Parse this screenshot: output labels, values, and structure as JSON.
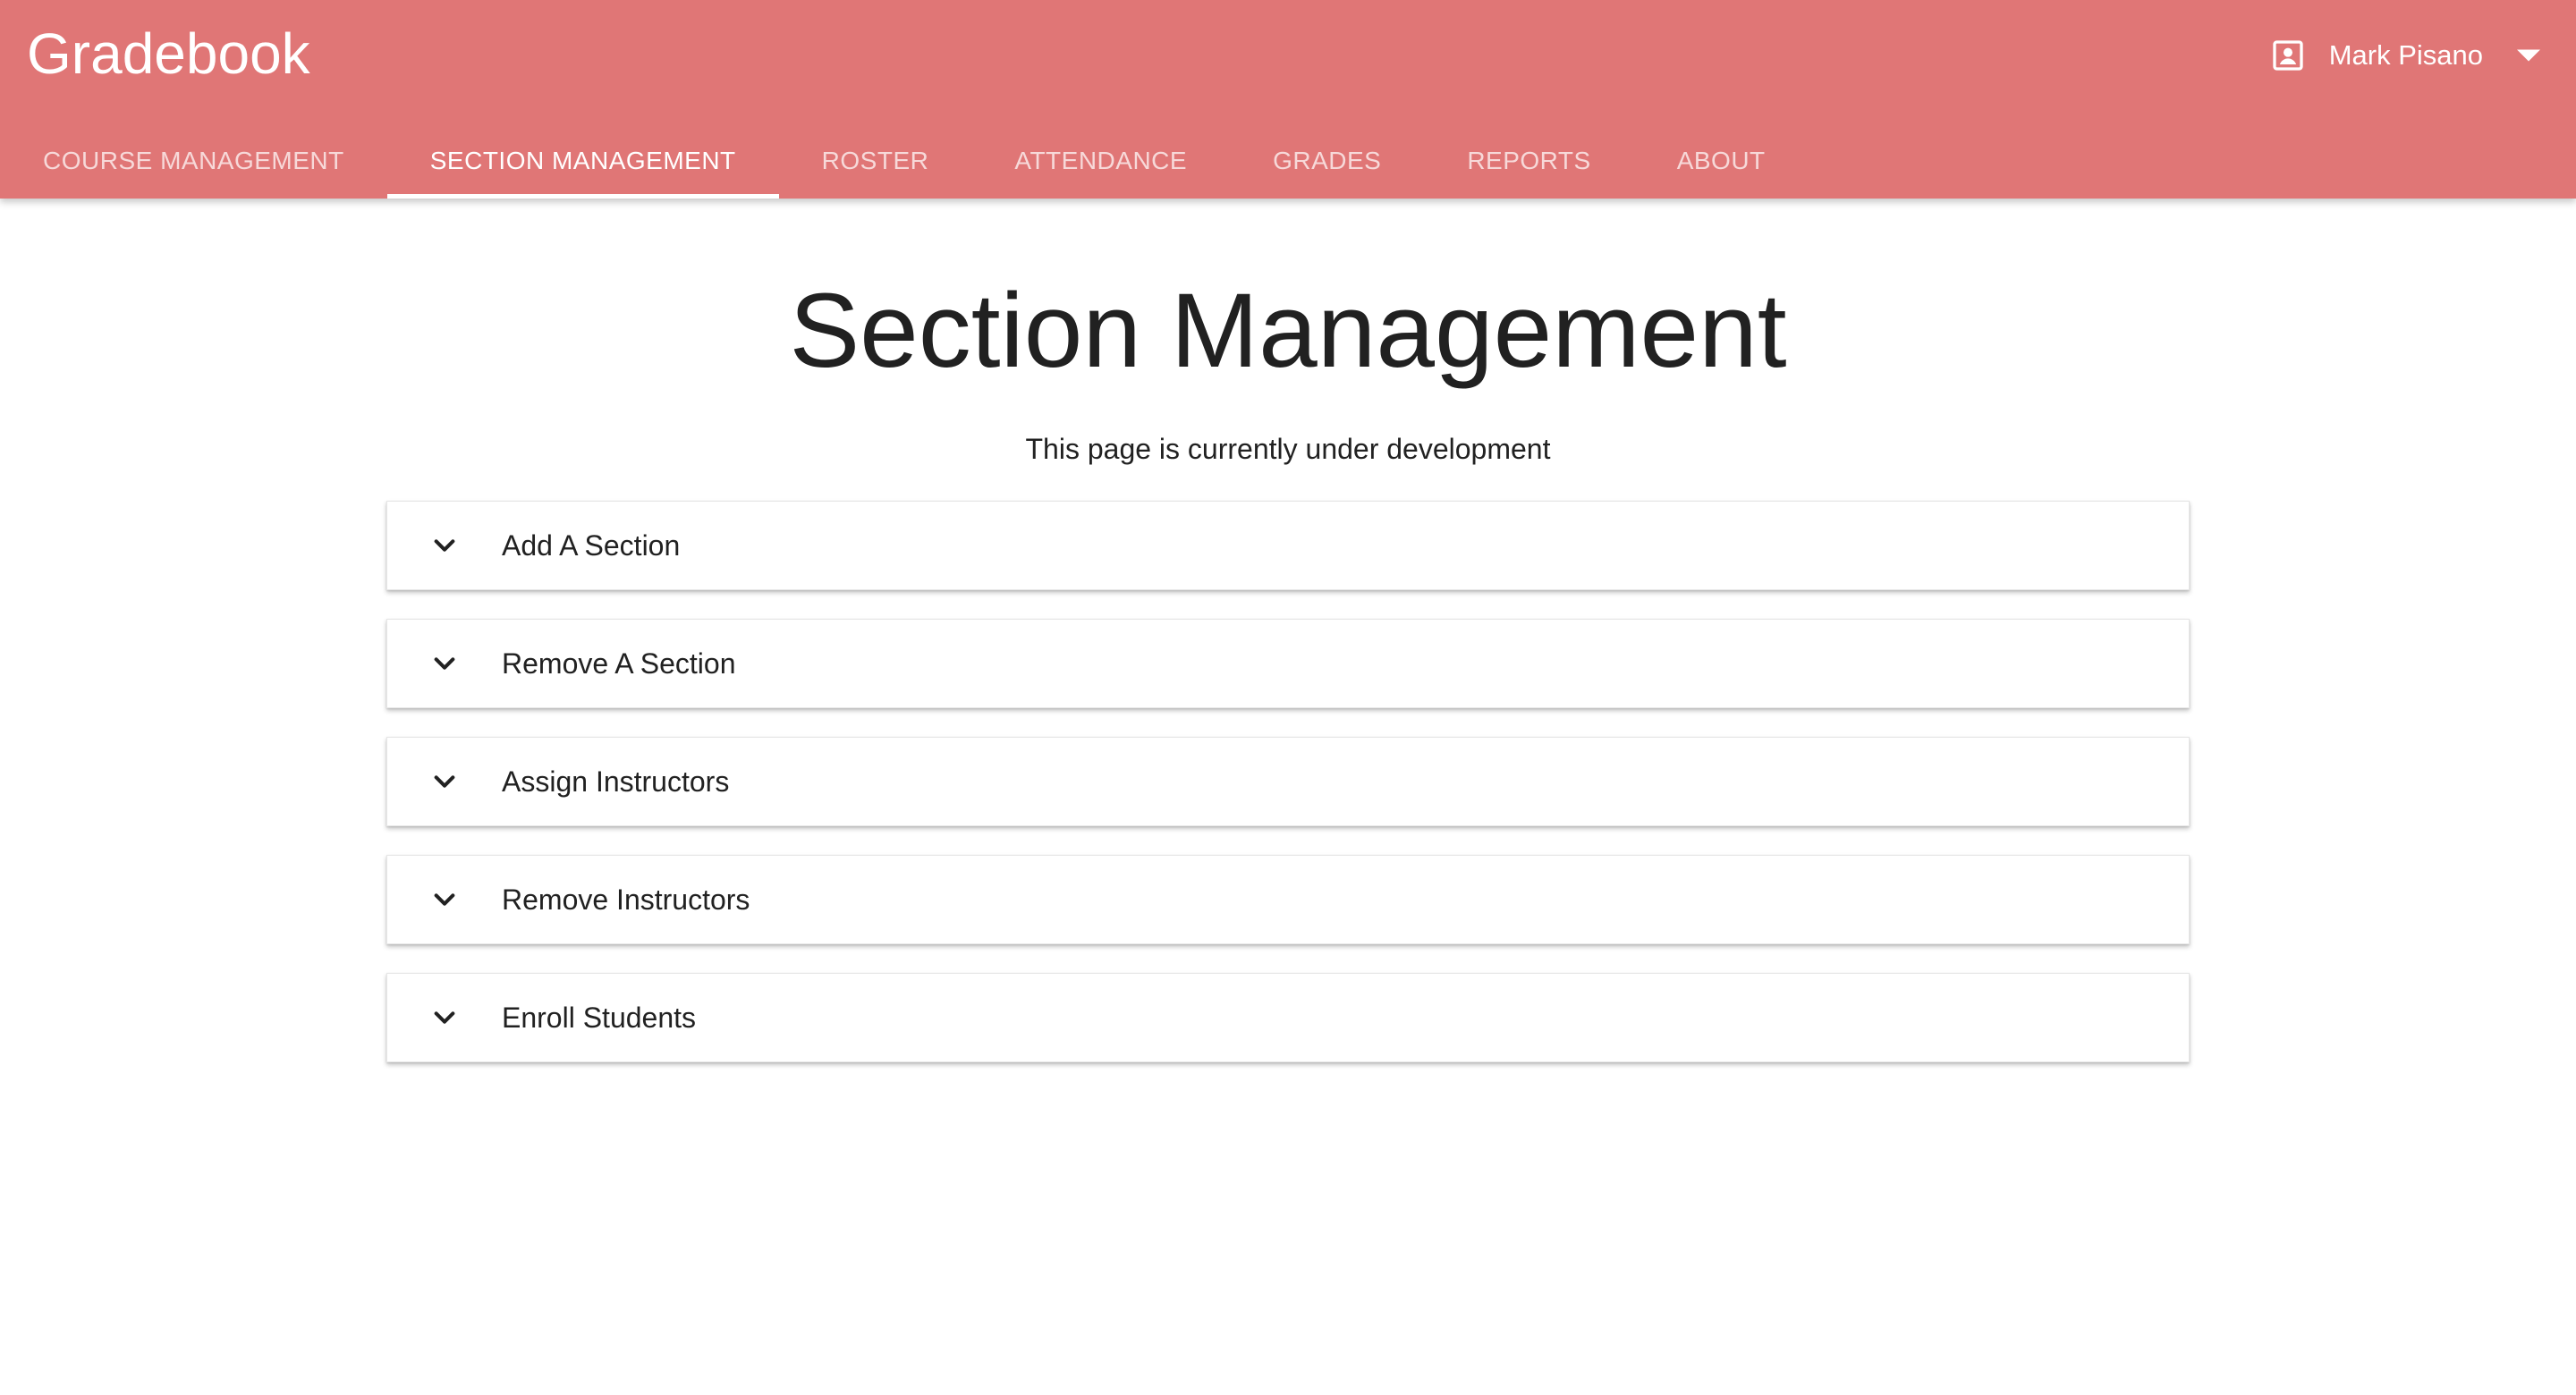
{
  "app": {
    "title": "Gradebook",
    "brand_color": "#e07676"
  },
  "user": {
    "name": "Mark Pisano",
    "icon": "account-box-icon",
    "menu_icon": "caret-down-icon"
  },
  "tabs": [
    {
      "label": "COURSE MANAGEMENT",
      "active": false
    },
    {
      "label": "SECTION MANAGEMENT",
      "active": true
    },
    {
      "label": "ROSTER",
      "active": false
    },
    {
      "label": "ATTENDANCE",
      "active": false
    },
    {
      "label": "GRADES",
      "active": false
    },
    {
      "label": "REPORTS",
      "active": false
    },
    {
      "label": "ABOUT",
      "active": false
    }
  ],
  "main": {
    "title": "Section Management",
    "subtitle": "This page is currently under development",
    "panels": [
      {
        "label": "Add A Section",
        "icon": "chevron-down-icon"
      },
      {
        "label": "Remove A Section",
        "icon": "chevron-down-icon"
      },
      {
        "label": "Assign Instructors",
        "icon": "chevron-down-icon"
      },
      {
        "label": "Remove Instructors",
        "icon": "chevron-down-icon"
      },
      {
        "label": "Enroll Students",
        "icon": "chevron-down-icon"
      }
    ]
  }
}
